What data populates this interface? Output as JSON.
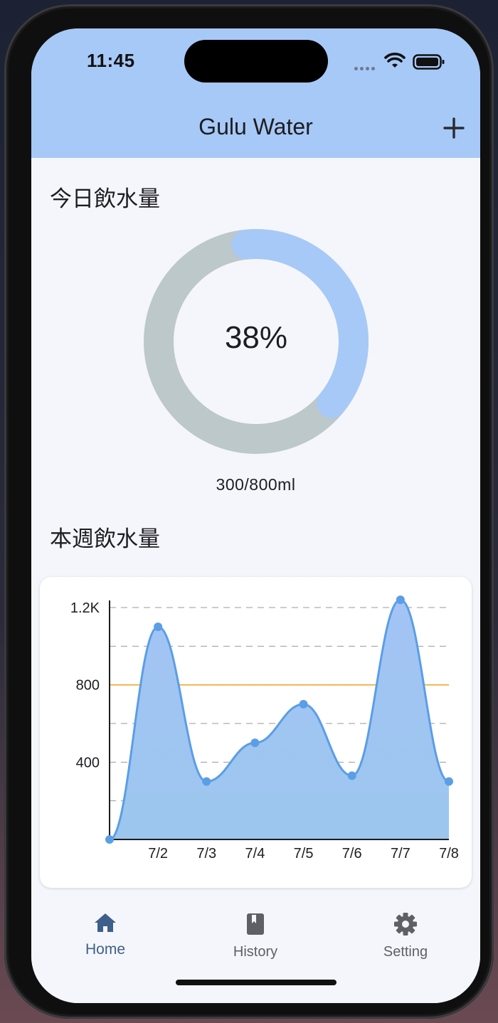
{
  "status_bar": {
    "time": "11:45"
  },
  "app_bar": {
    "title": "Gulu Water",
    "add_icon": "plus-icon"
  },
  "today": {
    "title": "今日飲水量",
    "percent_label": "38%",
    "percent": 0.375,
    "amount_label": "300/800ml"
  },
  "week": {
    "title": "本週飲水量"
  },
  "chart_data": {
    "type": "line",
    "categories": [
      "",
      "7/2",
      "7/3",
      "7/4",
      "7/5",
      "7/6",
      "7/7",
      "7/8"
    ],
    "values": [
      0,
      1100,
      300,
      500,
      700,
      330,
      1240,
      300
    ],
    "y_ticks": [
      "400",
      "800",
      "1.2K"
    ],
    "ylim": [
      0,
      1200
    ],
    "goal_line": 800,
    "grid": true,
    "area_fill": true,
    "colors": {
      "line": "#5a9ee6",
      "area": "#9cc6ee",
      "goal": "#f5a623",
      "grid": "#9a9a9a"
    }
  },
  "nav": {
    "items": [
      {
        "label": "Home",
        "icon": "home-icon",
        "active": true
      },
      {
        "label": "History",
        "icon": "book-icon",
        "active": false
      },
      {
        "label": "Setting",
        "icon": "gear-icon",
        "active": false
      }
    ]
  },
  "colors": {
    "app_bar": "#a7c9f7",
    "progress": "#a7c9f7",
    "track": "#bcc8c9",
    "active_nav": "#3e5f8a"
  }
}
